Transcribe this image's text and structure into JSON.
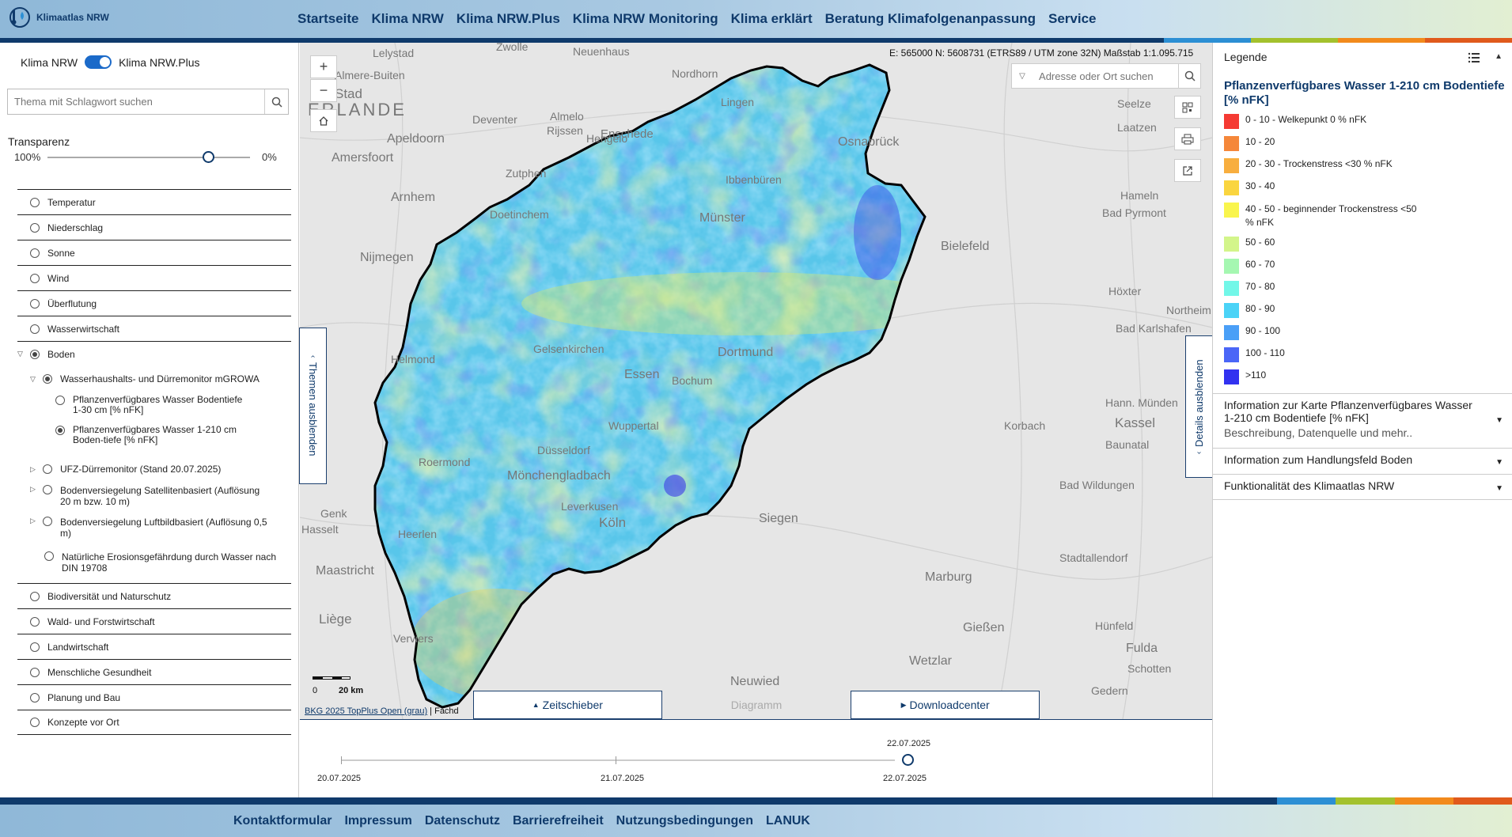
{
  "header": {
    "logo_text": "Klimaatlas NRW",
    "nav": [
      "Startseite",
      "Klima NRW",
      "Klima NRW.Plus",
      "Klima NRW Monitoring",
      "Klima erklärt",
      "Beratung Klimafolgenanpassung",
      "Service"
    ]
  },
  "left": {
    "toggle_left": "Klima NRW",
    "toggle_right": "Klima NRW.Plus",
    "search_placeholder": "Thema mit Schlagwort suchen",
    "transparency_label": "Transparenz",
    "transparency_min": "100%",
    "transparency_max": "0%",
    "transparency_value": 0.8,
    "topics": [
      {
        "label": "Temperatur"
      },
      {
        "label": "Niederschlag"
      },
      {
        "label": "Sonne"
      },
      {
        "label": "Wind"
      },
      {
        "label": "Überflutung"
      },
      {
        "label": "Wasserwirtschaft"
      },
      {
        "label": "Boden"
      },
      {
        "label": "Wasserhaushalts- und Dürremonitor mGROWA"
      },
      {
        "label": "Pflanzenverfügbares Wasser Bodentiefe 1-30 cm [% nFK]"
      },
      {
        "label": "Pflanzenverfügbares Wasser 1-210 cm Boden-tiefe [% nFK]"
      },
      {
        "label": "UFZ-Dürremonitor (Stand 20.07.2025)"
      },
      {
        "label": "Bodenversiegelung Satellitenbasiert (Auflösung 20 m bzw. 10 m)"
      },
      {
        "label": "Bodenversiegelung Luftbildbasiert (Auflösung 0,5 m)"
      },
      {
        "label": "Natürliche Erosionsgefährdung durch Wasser nach DIN 19708"
      },
      {
        "label": "Biodiversität und Naturschutz"
      },
      {
        "label": "Wald- und Forstwirtschaft"
      },
      {
        "label": "Landwirtschaft"
      },
      {
        "label": "Menschliche Gesundheit"
      },
      {
        "label": "Planung und Bau"
      },
      {
        "label": "Konzepte vor Ort"
      }
    ]
  },
  "map": {
    "coords": "E: 565000 N: 5608731  (ETRS89 / UTM zone 32N)  Maßstab 1:1.095.715",
    "address_placeholder": "Adresse oder Ort suchen",
    "themes_tab": "Themen ausblenden",
    "details_tab": "Details ausblenden",
    "scale_0": "0",
    "scale_20": "20 km",
    "attribution_link": "BKG 2025 TopPlus Open (grau)",
    "attribution_rest": " | Fachd",
    "tabs": [
      "Zeitschieber",
      "Diagramm",
      "Downloadcenter"
    ],
    "place_names": [
      "Lelystad",
      "Zwolle",
      "Neuenhaus",
      "Almere-Buiten",
      "Stad",
      "Nordhorn",
      "Lingen",
      "ERLANDE",
      "Deventer",
      "Apeldoorn",
      "Almelo",
      "Rijssen",
      "Hengelo",
      "Enschede",
      "Osnabrück",
      "Amersfoort",
      "Zutphen",
      "Ibbenbüren",
      "Seelze",
      "Laatzen",
      "Arnhem",
      "Doetinchem",
      "Münster",
      "Hameln",
      "Nijmegen",
      "Bielefeld",
      "Bad Pyrmont",
      "Höxter",
      "Northeim",
      "Bad Karlshafen",
      "Helmond",
      "Dortmund",
      "Essen",
      "Bochum",
      "Gelsenkirchen",
      "Hann. Münden",
      "Kassel",
      "Korbach",
      "Baunatal",
      "Roermond",
      "Wuppertal",
      "Mönchengladbach",
      "Düsseldorf",
      "Bad Wildungen",
      "Köln",
      "Leverkusen",
      "Genk",
      "Heerlen",
      "Maastricht",
      "Hasselt",
      "Siegen",
      "Marburg",
      "Gießen",
      "Liège",
      "Verviers",
      "Neuwied",
      "Wetzlar",
      "Fulda",
      "Hünfeld",
      "Stadtallendorf",
      "Schotten",
      "Gedern"
    ],
    "timeline": {
      "dates": [
        "20.07.2025",
        "21.07.2025",
        "22.07.2025"
      ],
      "current": "22.07.2025",
      "position": 1.0
    }
  },
  "legend": {
    "header": "Legende",
    "title": "Pflanzenverfügbares Wasser 1-210 cm Bodentiefe [% nFK]",
    "items": [
      {
        "label": "0 - 10 - Welkepunkt 0 % nFK",
        "color": "#f53a33"
      },
      {
        "label": "10 - 20",
        "color": "#f5873a"
      },
      {
        "label": "20 - 30 - Trockenstress <30 % nFK",
        "color": "#f8ae3e"
      },
      {
        "label": "30 - 40",
        "color": "#fad53f"
      },
      {
        "label": "40 - 50 - beginnender Trockenstress <50 % nFK",
        "color": "#f9f54d"
      },
      {
        "label": "50 - 60",
        "color": "#d3f58a"
      },
      {
        "label": "60 - 70",
        "color": "#a5f7b1"
      },
      {
        "label": "70 - 80",
        "color": "#72f7e8"
      },
      {
        "label": "80 - 90",
        "color": "#4bd3f7"
      },
      {
        "label": "90 - 100",
        "color": "#4a9ff7"
      },
      {
        "label": "100 - 110",
        "color": "#4a66f7"
      },
      {
        "label": ">110",
        "color": "#3232f0"
      }
    ],
    "accordions": [
      {
        "title": "Information zur Karte Pflanzenverfügbares Wasser 1-210 cm Bodentiefe [% nFK]",
        "subtitle": "Beschreibung, Datenquelle und mehr.."
      },
      {
        "title": "Information zum Handlungsfeld Boden",
        "subtitle": ""
      },
      {
        "title": "Funktionalität des Klimaatlas NRW",
        "subtitle": ""
      }
    ]
  },
  "footer": {
    "links": [
      "Kontaktformular",
      "Impressum",
      "Datenschutz",
      "Barrierefreiheit",
      "Nutzungsbedingungen",
      "LANUK"
    ]
  },
  "colors": {
    "brand": "#0f3a6b",
    "accent": "#1b6ac9",
    "stripes": [
      "#2c8fd4",
      "#a3c12d",
      "#f28a1c",
      "#e05a1c"
    ]
  }
}
